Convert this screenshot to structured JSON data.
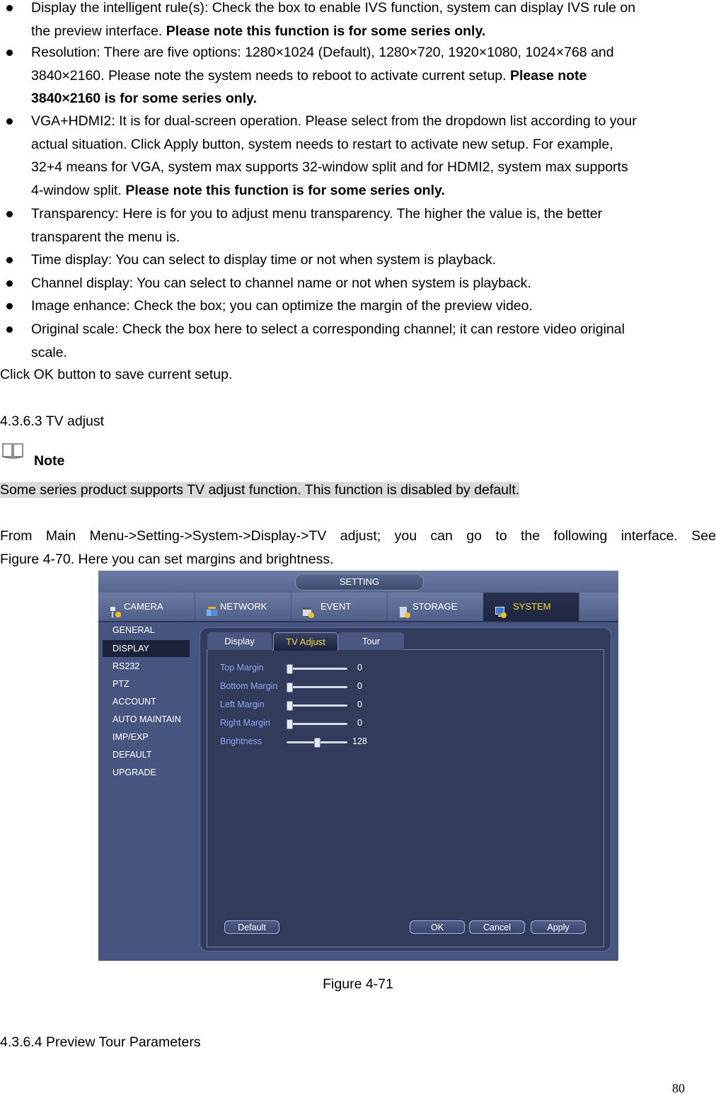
{
  "bullets_top": [
    {
      "lines": [
        {
          "text": "Display the intelligent rule(s): Check the box to enable IVS function, system can display IVS rule on"
        },
        {
          "text": "the preview interface. ",
          "bold": "Please note this function is for some series only."
        }
      ]
    },
    {
      "lines": [
        {
          "text": "Resolution: There are five options: 1280×1024 (Default), 1280×720, 1920×1080, 1024×768 and"
        },
        {
          "text": "3840×2160. Please note the system needs to reboot to activate current setup. ",
          "bold": "Please note"
        },
        {
          "text": "",
          "bold": "3840×2160 is for some series only."
        }
      ]
    },
    {
      "lines": [
        {
          "text": "VGA+HDMI2: It is for dual-screen operation. Please select from the dropdown list according to your"
        },
        {
          "text": "actual situation. Click Apply button, system needs to restart to activate new setup. For example,"
        },
        {
          "text": "32+4 means for VGA, system max supports 32-window split and for HDMI2, system max supports"
        },
        {
          "text": "4-window split. ",
          "bold": "Please note this function is for some series only."
        }
      ]
    },
    {
      "lines": [
        {
          "text": "Transparency: Here is for you to adjust menu transparency. The higher the value is, the better"
        },
        {
          "text": "transparent the menu is."
        }
      ]
    },
    {
      "lines": [
        {
          "text": "Time display: You can select to display time or not when system is playback."
        }
      ]
    },
    {
      "lines": [
        {
          "text": "Channel display: You can select to channel name or not when system is playback."
        }
      ]
    },
    {
      "lines": [
        {
          "text": "Image enhance: Check the box; you can optimize the margin of the preview video."
        }
      ]
    },
    {
      "lines": [
        {
          "text": "Original scale: Check the box here to select a corresponding channel; it can restore video original"
        },
        {
          "text": "scale."
        }
      ]
    }
  ],
  "save_note": "Click OK button to save current setup.",
  "section_tv": "4.3.6.3 TV adjust",
  "note_label": "Note",
  "note_text": "Some series product supports TV adjust function. This function is disabled by default.",
  "intro_line1": "From Main Menu->Setting->System->Display->TV adjust; you can go to the following interface. See",
  "intro_line2": "Figure 4-70. Here you can set margins and brightness.",
  "figure": {
    "title": "SETTING",
    "nav_tabs": [
      {
        "label": "CAMERA",
        "icon": "camera-settings-icon"
      },
      {
        "label": "NETWORK",
        "icon": "network-icon"
      },
      {
        "label": "EVENT",
        "icon": "event-icon"
      },
      {
        "label": "STORAGE",
        "icon": "storage-icon"
      },
      {
        "label": "SYSTEM",
        "icon": "system-monitor-icon",
        "active": true
      }
    ],
    "sidebar": [
      "GENERAL",
      "DISPLAY",
      "RS232",
      "PTZ",
      "ACCOUNT",
      "AUTO MAINTAIN",
      "IMP/EXP",
      "DEFAULT",
      "UPGRADE"
    ],
    "sidebar_active": "DISPLAY",
    "sub_tabs": [
      "Display",
      "TV Adjust",
      "Tour"
    ],
    "sub_tab_active": "TV Adjust",
    "sliders": [
      {
        "label": "Top Margin",
        "value": "0",
        "fraction": 0.0
      },
      {
        "label": "Bottom Margin",
        "value": "0",
        "fraction": 0.0
      },
      {
        "label": "Left Margin",
        "value": "0",
        "fraction": 0.0
      },
      {
        "label": "Right Margin",
        "value": "0",
        "fraction": 0.0
      },
      {
        "label": "Brightness",
        "value": "128",
        "fraction": 0.5
      }
    ],
    "buttons": {
      "default": "Default",
      "ok": "OK",
      "cancel": "Cancel",
      "apply": "Apply"
    },
    "colors": {
      "active_tab_text": "#f5d630",
      "slider_label": "#8fa6ef",
      "background": "#475680"
    }
  },
  "caption": "Figure 4-71",
  "section_tour": "4.3.6.4 Preview Tour Parameters",
  "page_number": "80"
}
